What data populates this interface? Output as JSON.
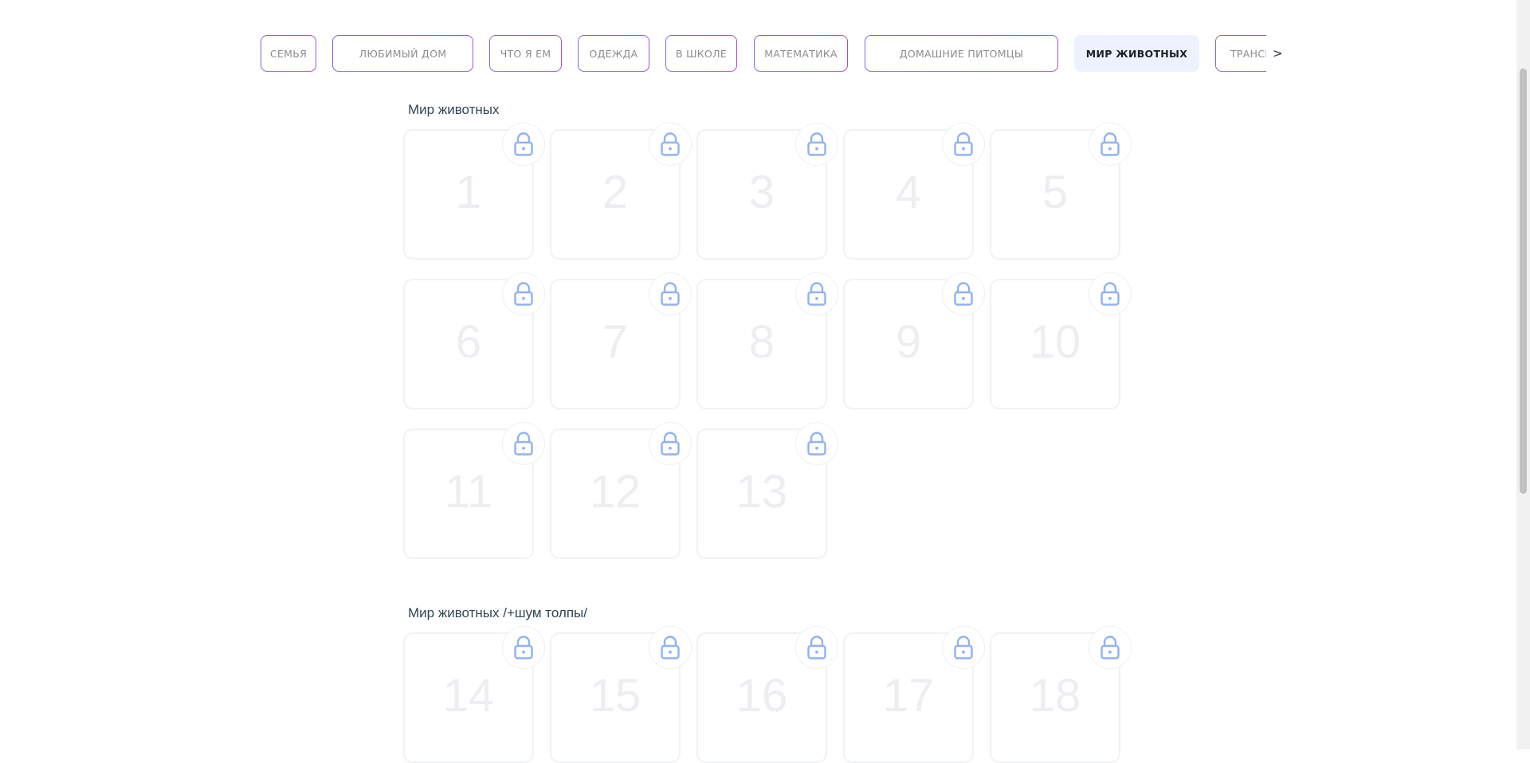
{
  "tabs": [
    {
      "label": "СЕМЬЯ",
      "active": false
    },
    {
      "label": "ЛЮБИМЫЙ ДОМ",
      "active": false
    },
    {
      "label": "ЧТО Я ЕМ",
      "active": false
    },
    {
      "label": "ОДЕЖДА",
      "active": false
    },
    {
      "label": "В ШКОЛЕ",
      "active": false
    },
    {
      "label": "МАТЕМАТИКА",
      "active": false
    },
    {
      "label": "ДОМАШНИЕ ПИТОМЦЫ",
      "active": false
    },
    {
      "label": "МИР ЖИВОТНЫХ",
      "active": true
    },
    {
      "label": "ТРАНСПОРТ",
      "active": false
    }
  ],
  "tabs_next_label": ">",
  "sections": [
    {
      "title": "Мир животных",
      "cards": [
        "1",
        "2",
        "3",
        "4",
        "5",
        "6",
        "7",
        "8",
        "9",
        "10",
        "11",
        "12",
        "13"
      ],
      "locked": true
    },
    {
      "title": "Мир животных /+шум толпы/",
      "cards": [
        "14",
        "15",
        "16",
        "17",
        "18"
      ],
      "locked": true
    }
  ],
  "icons": {
    "card_lock": "lock-icon",
    "tabs_next": "chevron-right-icon"
  },
  "colors": {
    "tab_border_start": "#6d6cf0",
    "tab_border_end": "#b04ad8",
    "active_tab_bg": "#edf2fe",
    "lock_icon": "#8fb2f4",
    "section_title": "#2e4656"
  }
}
